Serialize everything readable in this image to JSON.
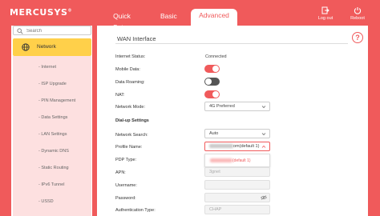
{
  "header": {
    "logo": "MERCUSYS",
    "tabs": {
      "quick_setup": "Quick Setup",
      "basic": "Basic",
      "advanced": "Advanced"
    },
    "log_out": "Log out",
    "reboot": "Reboot"
  },
  "sidebar": {
    "search_placeholder": "Search",
    "section": "Network",
    "items": [
      "Internet",
      "ISP Upgrade",
      "PIN Management",
      "Data Settings",
      "LAN Settings",
      "Dynamic DNS",
      "Static Routing",
      "IPv6 Tunnel",
      "USSD"
    ]
  },
  "panel": {
    "title": "WAN Interface",
    "internet_status_label": "Internet Status:",
    "internet_status_value": "Connected",
    "mobile_data_label": "Mobile Data:",
    "mobile_data_on": true,
    "data_roaming_label": "Data Roaming:",
    "data_roaming_on": false,
    "nat_label": "NAT:",
    "nat_on": true,
    "network_mode_label": "Network Mode:",
    "network_mode_value": "4G Preferred",
    "dialup_heading": "Dial-up Settings",
    "network_search_label": "Network Search:",
    "network_search_value": "Auto",
    "profile_name_label": "Profile Name:",
    "profile_name_suffix": "om(default 1)",
    "profile_option_suffix": "(default 1)",
    "pdp_type_label": "PDP Type:",
    "apn_label": "APN:",
    "apn_value": "3gnet",
    "username_label": "Username:",
    "password_label": "Password:",
    "auth_type_label": "Authentication Type:",
    "auth_type_value": "CHAP"
  },
  "colors": {
    "brand": "#f05a5b",
    "nav_active": "#ffd04a",
    "subnav_bg": "#fde0e0"
  }
}
